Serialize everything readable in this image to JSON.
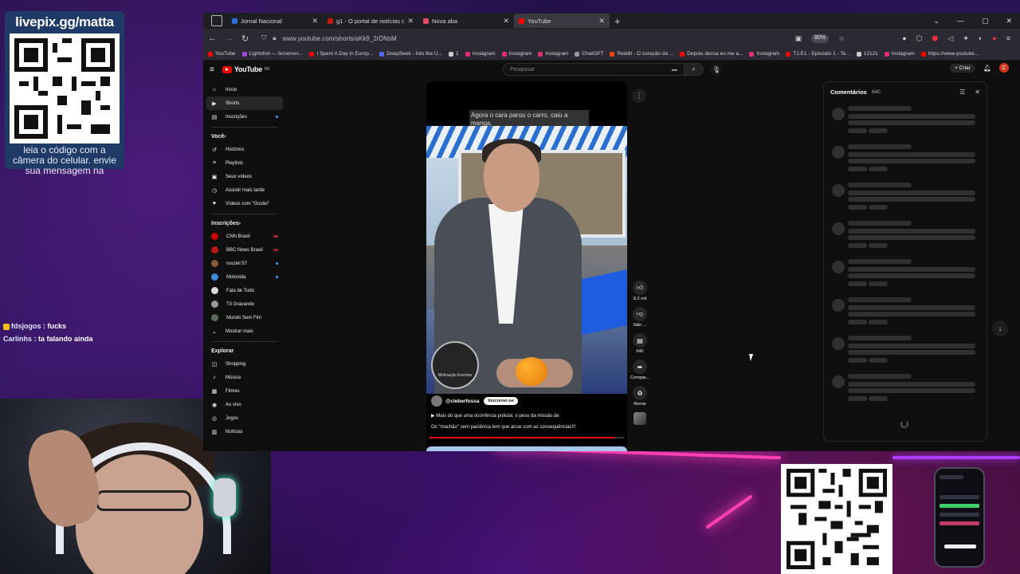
{
  "overlay": {
    "livepix_title": "livepix.gg/matta",
    "livepix_caption": "leia o código com a câmera do celular. envie sua mensagem na",
    "chat": [
      {
        "user": "fdsjogos",
        "message": "fucks"
      },
      {
        "user": "Carlinhs",
        "message": "ta falando ainda"
      }
    ]
  },
  "browser": {
    "tabs": [
      {
        "label": "Jornal Nacional",
        "color": "#2b6fd8",
        "active": false
      },
      {
        "label": "g1 - O portal de notícias da Gl",
        "color": "#c4170c",
        "active": false
      },
      {
        "label": "Nova aba",
        "color": "#e54a6a",
        "active": false
      },
      {
        "label": "YouTube",
        "color": "#ff0000",
        "active": true
      }
    ],
    "url": "www.youtube.com/shorts/aKk9_2rDNsM",
    "zoom": "80%",
    "bookmarks": [
      {
        "label": "YouTube",
        "color": "#ff0000"
      },
      {
        "label": "Lightshot — ferramen...",
        "color": "#a04cd8"
      },
      {
        "label": "I Spent A Day in Europ...",
        "color": "#ff0000"
      },
      {
        "label": "DeepSeek - Into the U...",
        "color": "#4d6bfe"
      },
      {
        "label": "1",
        "color": "#cccccc"
      },
      {
        "label": "Instagram",
        "color": "#e1306c"
      },
      {
        "label": "Instagram",
        "color": "#e1306c"
      },
      {
        "label": "Instagram",
        "color": "#e1306c"
      },
      {
        "label": "ChatGPT",
        "color": "#9a9a9a"
      },
      {
        "label": "Reddit - O coração da ...",
        "color": "#ff4500"
      },
      {
        "label": "Depois dessa eu me a...",
        "color": "#ff0000"
      },
      {
        "label": "Instagram",
        "color": "#e1306c"
      },
      {
        "label": "T1:E1 - Episódio 1 - Te...",
        "color": "#e50914"
      },
      {
        "label": "12121",
        "color": "#cccccc"
      },
      {
        "label": "Instagram",
        "color": "#e1306c"
      },
      {
        "label": "https://www.youtube...",
        "color": "#ff0000"
      }
    ]
  },
  "youtube": {
    "logo": "YouTube",
    "logo_sup": "BR",
    "search_placeholder": "Pesquisar",
    "create_label": "Criar",
    "avatar_letter": "C",
    "nav": [
      {
        "label": "Início",
        "icon": "home-icon",
        "glyph": "⌂"
      },
      {
        "label": "Shorts",
        "icon": "shorts-icon",
        "glyph": "▶"
      },
      {
        "label": "Inscrições",
        "icon": "subscriptions-icon",
        "glyph": "▤"
      }
    ],
    "you_section": "Você",
    "you_items": [
      {
        "label": "Histórico",
        "icon": "history-icon",
        "glyph": "↺"
      },
      {
        "label": "Playlists",
        "icon": "playlists-icon",
        "glyph": "≡"
      },
      {
        "label": "Seus vídeos",
        "icon": "your-videos-icon",
        "glyph": "▣"
      },
      {
        "label": "Assistir mais tarde",
        "icon": "watch-later-icon",
        "glyph": "◷"
      },
      {
        "label": "Vídeos com \"Gostei\"",
        "icon": "liked-icon",
        "glyph": "♥"
      }
    ],
    "subs_section": "Inscrições",
    "subs": [
      {
        "label": "CNN Brasil",
        "color": "#cc0000",
        "live": true
      },
      {
        "label": "BBC News Brasil",
        "color": "#bb1919",
        "live": true
      },
      {
        "label": "roozlel 57",
        "color": "#8a5a3a",
        "dot": true
      },
      {
        "label": "Motovida",
        "color": "#3a8ad8",
        "dot": true
      },
      {
        "label": "Fala de Tudo",
        "color": "#d8d8d8"
      },
      {
        "label": "Tô Gravando",
        "color": "#9a9a9a"
      },
      {
        "label": "Mundo Sem Fim",
        "color": "#5a6a5a"
      }
    ],
    "show_more": "Mostrar mais",
    "explore_section": "Explorar",
    "explore": [
      {
        "label": "Shopping",
        "icon": "shopping-icon",
        "glyph": "◫"
      },
      {
        "label": "Música",
        "icon": "music-icon",
        "glyph": "♪"
      },
      {
        "label": "Filmes",
        "icon": "films-icon",
        "glyph": "▦"
      },
      {
        "label": "Ao vivo",
        "icon": "live-icon",
        "glyph": "◉"
      },
      {
        "label": "Jogos",
        "icon": "games-icon",
        "glyph": "◎"
      },
      {
        "label": "Notícias",
        "icon": "news-icon",
        "glyph": "▥"
      }
    ],
    "short": {
      "caption": "Agora o cara parou o carro, caiu a manga,",
      "watermark": "Motivação Eventos",
      "channel": "@cleberfossa",
      "subscribe_label": "Inscrever-se",
      "desc_line1": "▶  Mais do que uma ocorrência policial, o peso da missão de",
      "desc_line2": "Os \"machão\" sem paciência tem que arcar com as consequências!!!",
      "progress": 0.95
    },
    "actions": {
      "likes": "8,2 mil",
      "dislike_label": "Não ...",
      "comments": "640",
      "share_label": "Compar...",
      "remix_label": "Remix"
    },
    "comments_panel": {
      "title": "Comentários",
      "count": "640"
    }
  }
}
